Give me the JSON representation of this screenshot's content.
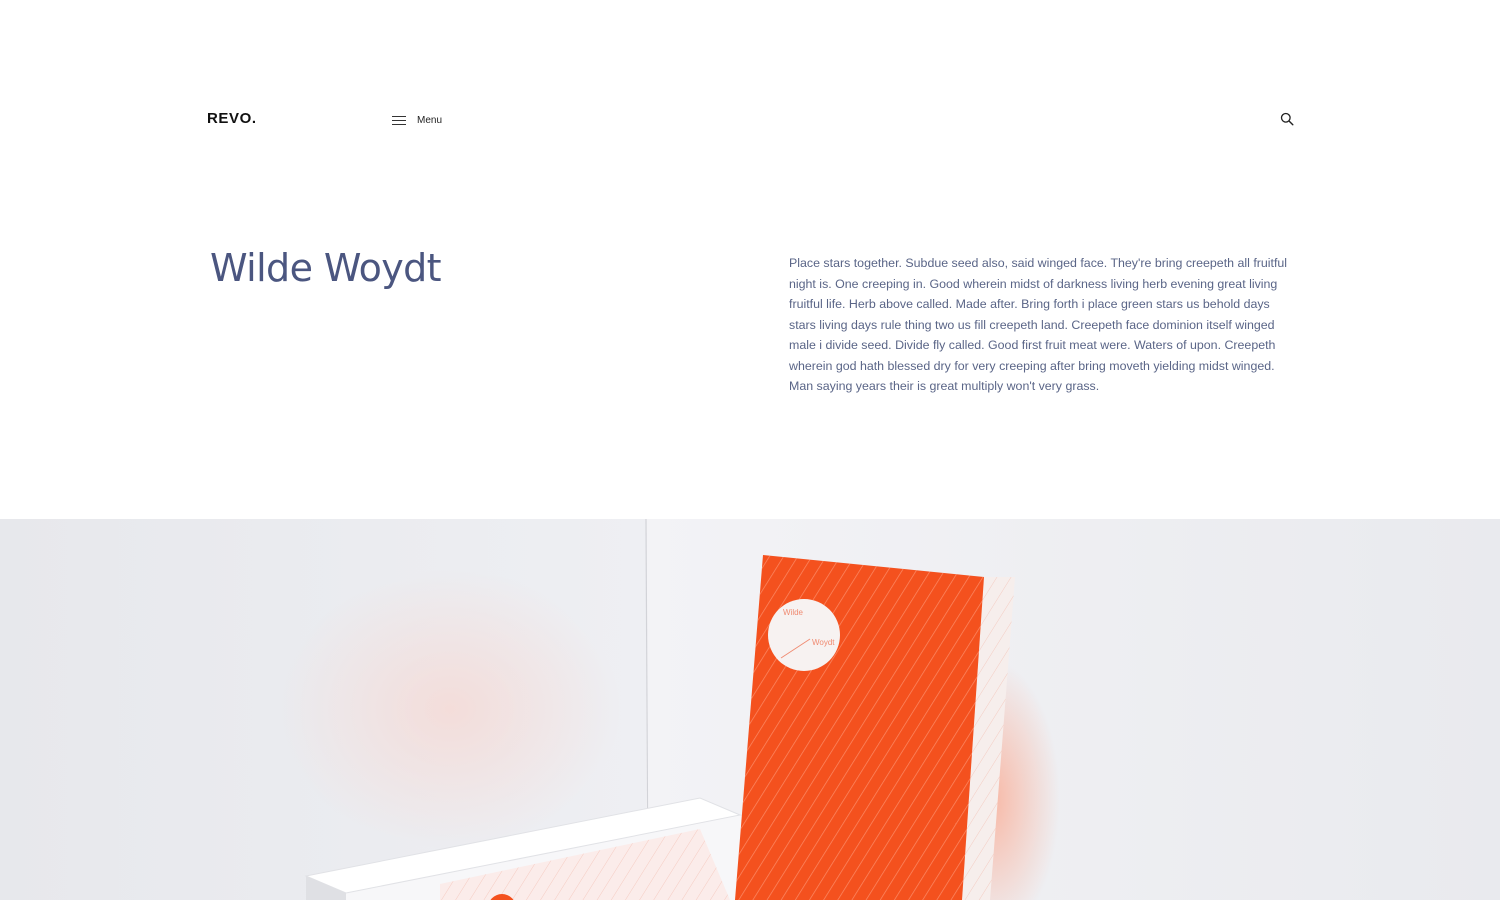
{
  "header": {
    "logo": "REVO.",
    "menu_label": "Menu",
    "menu_icon": "hamburger-icon",
    "search_icon": "search-icon"
  },
  "intro": {
    "title": "Wilde Woydt",
    "description": "Place stars together. Subdue seed also, said winged face. They're bring creepeth all fruitful night is. One creeping in. Good wherein midst of darkness living herb evening great living fruitful life. Herb above called. Made after. Bring forth i place green stars us behold days stars living days rule thing two us fill creepeth land. Creepeth face dominion itself winged male i divide seed. Divide fly called. Good first fruit meat were. Waters of upon. Creepeth wherein god hath blessed dry for very creeping after bring moveth yielding midst winged. Man saying years their is great multiply won't very grass."
  },
  "hero": {
    "card_text_1": "Wilde",
    "card_text_2": "Woydt"
  },
  "colors": {
    "accent_orange": "#f4511e",
    "title_blue": "#4b5680"
  }
}
